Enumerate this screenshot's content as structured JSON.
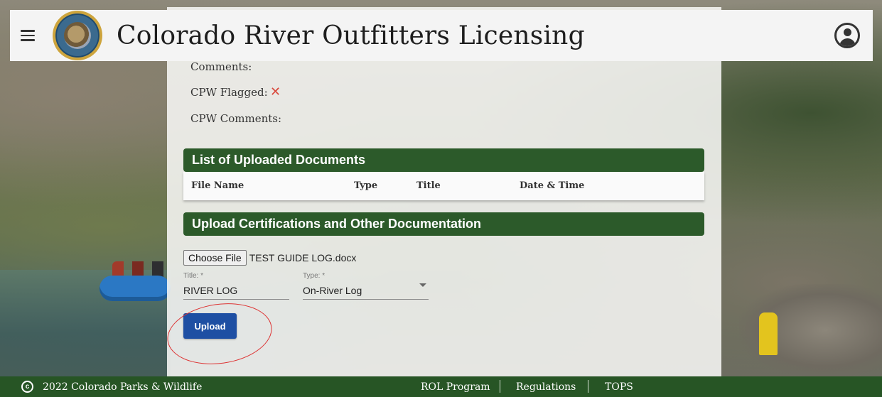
{
  "header": {
    "title": "Colorado River Outfitters Licensing",
    "menu_icon": "hamburger-menu-icon",
    "logo_text": "Colorado Parks & Wildlife",
    "account_icon": "account-circle-icon"
  },
  "details": {
    "comments_label": "Comments:",
    "cpw_flagged_label": "CPW Flagged:",
    "cpw_flagged_value_icon": "close-x-icon",
    "cpw_comments_label": "CPW Comments:"
  },
  "documents": {
    "section_title": "List of Uploaded Documents",
    "columns": [
      "File Name",
      "Type",
      "Title",
      "Date & Time"
    ]
  },
  "upload": {
    "section_title": "Upload Certifications and Other Documentation",
    "choose_file_label": "Choose File",
    "selected_file": "TEST GUIDE LOG.docx",
    "title_label": "Title: *",
    "title_value": "RIVER LOG",
    "type_label": "Type: *",
    "type_value": "On-River Log",
    "upload_button": "Upload"
  },
  "footer": {
    "copyright": "2022 Colorado Parks & Wildlife",
    "links": [
      "ROL Program",
      "Regulations",
      "TOPS"
    ]
  },
  "colors": {
    "brand_green": "#2c5a2a",
    "footer_green": "#275525",
    "primary_button": "#1e4fa3",
    "annotation_red": "#d33333"
  }
}
